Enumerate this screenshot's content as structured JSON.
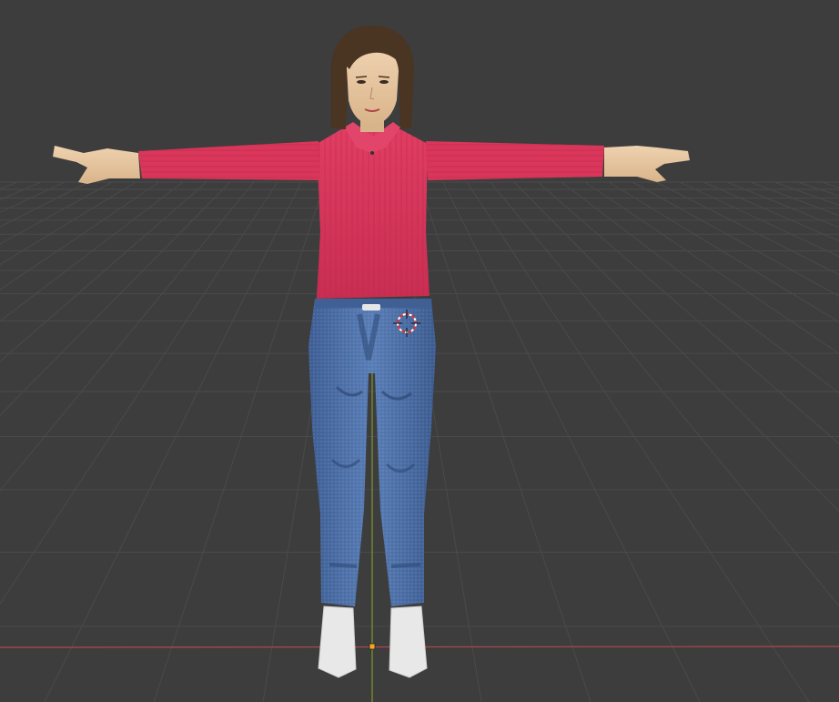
{
  "viewport": {
    "background_color": "#3d3d3d",
    "grid_color": "#4a4a4a",
    "grid_color_strong": "#525252",
    "x_axis_color": "#b4484e",
    "y_axis_color": "#7a9a2e",
    "origin_color": "#f5a623"
  },
  "scene": {
    "object_icon": "character-mesh-icon",
    "cursor_icon": "3d-cursor-icon",
    "colors": {
      "sweater": "#d9365a",
      "sweater_shadow": "#b82a4a",
      "jeans": "#4a6ea6",
      "jeans_shadow": "#2f4a78",
      "skin": "#e3c199",
      "hair": "#4a3422",
      "shoes": "#e6e6e6"
    }
  }
}
